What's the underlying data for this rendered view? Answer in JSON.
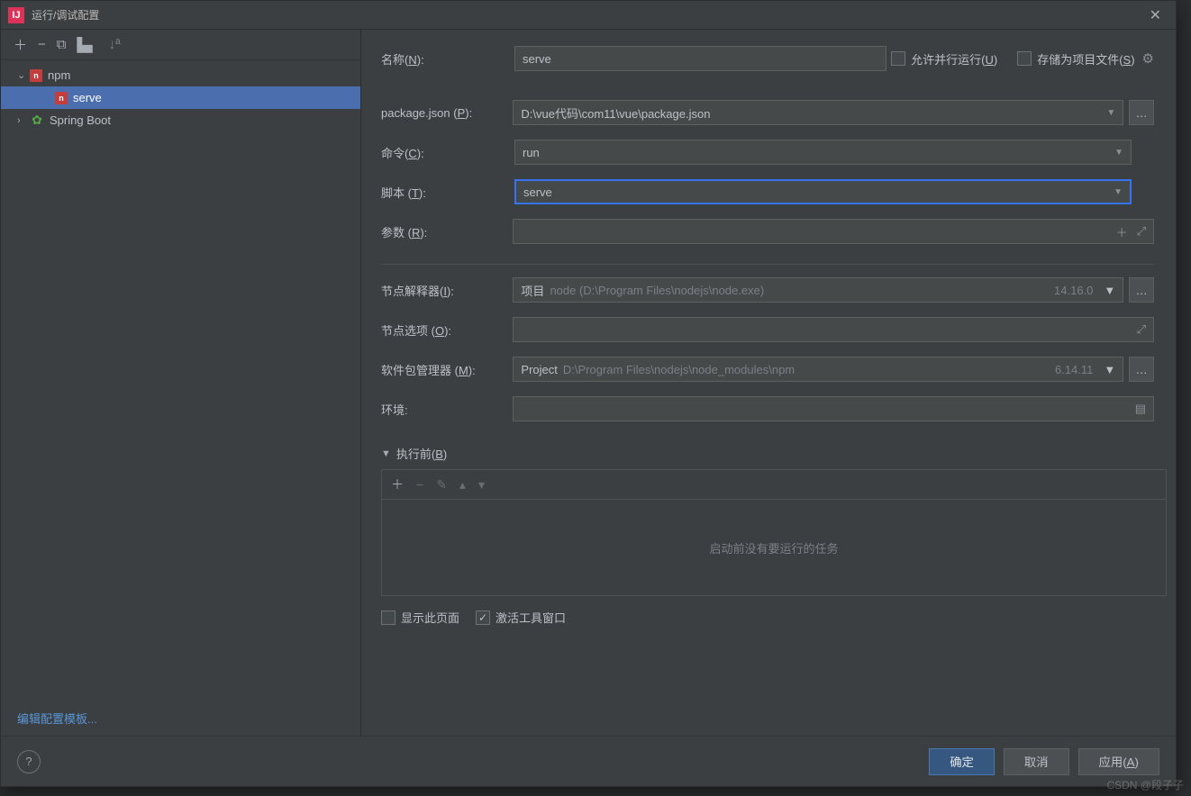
{
  "titlebar": {
    "title": "运行/调试配置"
  },
  "sidebar": {
    "items": [
      {
        "label": "npm",
        "type": "npm",
        "expandable": true,
        "expanded": true
      },
      {
        "label": "serve",
        "type": "npm",
        "child": true,
        "selected": true
      },
      {
        "label": "Spring Boot",
        "type": "spring",
        "expandable": true,
        "expanded": false
      }
    ],
    "link": "编辑配置模板..."
  },
  "form": {
    "name_label": "名称(N):",
    "name_value": "serve",
    "allow_parallel": "允许并行运行(U)",
    "store_project": "存储为项目文件(S)",
    "package_json_label": "package.json (P):",
    "package_json_value": "D:\\vue代码\\com11\\vue\\package.json",
    "command_label": "命令(C):",
    "command_value": "run",
    "script_label": "脚本 (T):",
    "script_value": "serve",
    "args_label": "参数 (R):",
    "interpreter_label": "节点解释器(I):",
    "interpreter_project": "项目",
    "interpreter_path": "node (D:\\Program Files\\nodejs\\node.exe)",
    "interpreter_version": "14.16.0",
    "node_opts_label": "节点选项 (O):",
    "pkg_manager_label": "软件包管理器 (M):",
    "pkg_manager_project": "Project",
    "pkg_manager_path": "D:\\Program Files\\nodejs\\node_modules\\npm",
    "pkg_manager_version": "6.14.11",
    "env_label": "环境:"
  },
  "before_run": {
    "header": "执行前(B)",
    "empty": "启动前没有要运行的任务",
    "show_page": "显示此页面",
    "activate_tool": "激活工具窗口"
  },
  "buttons": {
    "ok": "确定",
    "cancel": "取消",
    "apply": "应用(A)"
  },
  "watermark": "CSDN @段子子"
}
